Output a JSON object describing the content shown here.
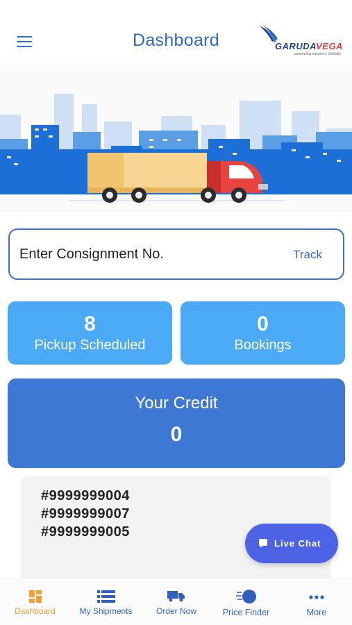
{
  "header": {
    "title": "Dashboard",
    "logo": {
      "text_main": "GARUDA",
      "text_accent": "VEGA",
      "tagline": "connecting emotions, Globally"
    }
  },
  "track": {
    "placeholder": "Enter Consignment No.",
    "button_label": "Track"
  },
  "stats": [
    {
      "value": "8",
      "label": "Pickup Scheduled"
    },
    {
      "value": "0",
      "label": "Bookings"
    }
  ],
  "credit": {
    "title": "Your Credit",
    "value": "0"
  },
  "consignments": [
    "#9999999004",
    "#9999999007",
    "#9999999005"
  ],
  "live_chat": {
    "label": "Live Chat"
  },
  "bottom_nav": [
    {
      "label": "Dashboard",
      "icon": "dashboard-icon",
      "active": true
    },
    {
      "label": "My Shipments",
      "icon": "list-icon",
      "active": false
    },
    {
      "label": "Order Now",
      "icon": "truck-icon",
      "active": false
    },
    {
      "label": "Price Finder",
      "icon": "price-finder-icon",
      "active": false
    },
    {
      "label": "More",
      "icon": "more-icon",
      "active": false
    }
  ],
  "colors": {
    "accent_blue": "#2f6bc4",
    "card_light_blue": "#4aaaf6",
    "credit_blue": "#3d79d4",
    "chat_blue": "#4d63e6",
    "nav_active": "#f2a036"
  }
}
